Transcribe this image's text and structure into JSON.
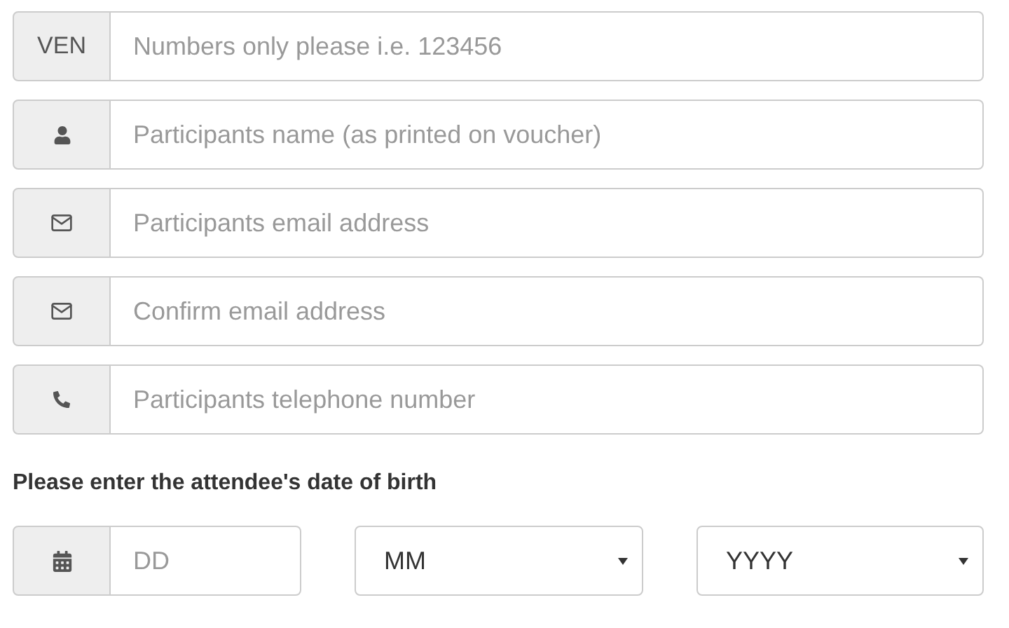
{
  "fields": [
    {
      "kind": "text",
      "addon": "VEN",
      "placeholder": "Numbers only please i.e. 123456"
    },
    {
      "kind": "user",
      "placeholder": "Participants name (as printed on voucher)"
    },
    {
      "kind": "email",
      "placeholder": "Participants email address"
    },
    {
      "kind": "email",
      "placeholder": "Confirm email address"
    },
    {
      "kind": "phone",
      "placeholder": "Participants telephone number"
    }
  ],
  "dob": {
    "label": "Please enter the attendee's date of birth",
    "day": {
      "placeholder": "DD"
    },
    "month": {
      "value": "MM"
    },
    "year": {
      "value": "YYYY"
    }
  }
}
